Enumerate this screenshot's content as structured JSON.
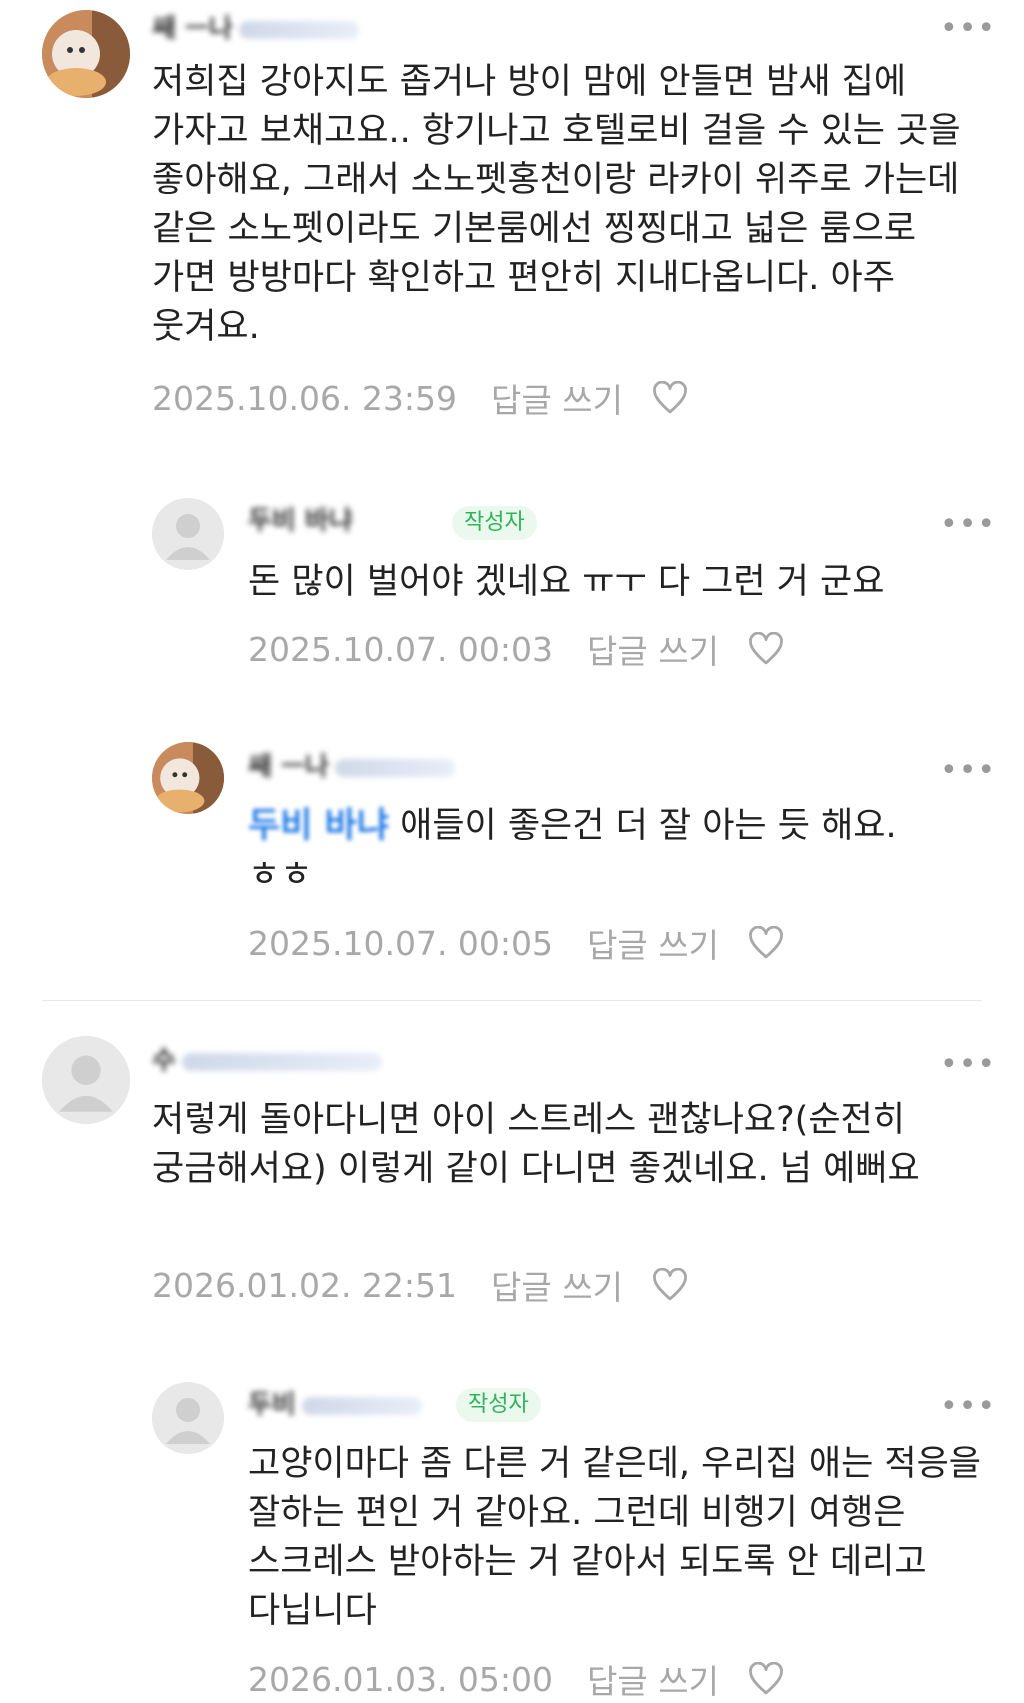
{
  "comments": [
    {
      "author": "쌔 ㅡ나",
      "text": "저희집 강아지도 좁거나 방이 맘에 안들면 밤새 집에 가자고 보채고요.. 항기나고 호텔로비 걸을 수 있는 곳을 좋아해요, 그래서 소노펫홍천이랑 라카이 위주로 가는데 같은 소노펫이라도 기본룸에선 찡찡대고 넓은 룸으로 가면 방방마다 확인하고 편안히 지내다옵니다. 아주 웃겨요.",
      "date": "2025.10.06. 23:59",
      "reply_label": "답글 쓰기"
    },
    {
      "author": "두비 바냐",
      "badge": "작성자",
      "text": "돈 많이 벌어야 겠네요 ㅠㅜ 다 그런 거 군요",
      "date": "2025.10.07. 00:03",
      "reply_label": "답글 쓰기"
    },
    {
      "author": "쌔 ㅡ나",
      "mention": "두비 바냐",
      "text": " 애들이 좋은건 더 잘 아는 듯 해요. ㅎㅎ",
      "date": "2025.10.07. 00:05",
      "reply_label": "답글 쓰기"
    },
    {
      "author": "수",
      "text": "저렇게 돌아다니면 아이 스트레스 괜찮나요?(순전히 궁금해서요) 이렇게 같이 다니면 좋겠네요. 넘 예뻐요",
      "date": "2026.01.02. 22:51",
      "reply_label": "답글 쓰기"
    },
    {
      "author": "두비",
      "badge": "작성자",
      "text": "고양이마다 좀 다른 거 같은데, 우리집 애는 적응을 잘하는 편인 거 같아요. 그런데 비행기 여행은 스크레스 받아하는 거 같아서 되도록 안 데리고 다닙니다",
      "date": "2026.01.03. 05:00",
      "reply_label": "답글 쓰기"
    }
  ],
  "more_glyph": "•••",
  "colors": {
    "accent_blue": "#1e78e6",
    "badge_green": "#2fb45a",
    "meta_gray": "#a8a8a8"
  },
  "icons": [
    "more-icon",
    "heart-icon",
    "default-avatar-icon"
  ]
}
